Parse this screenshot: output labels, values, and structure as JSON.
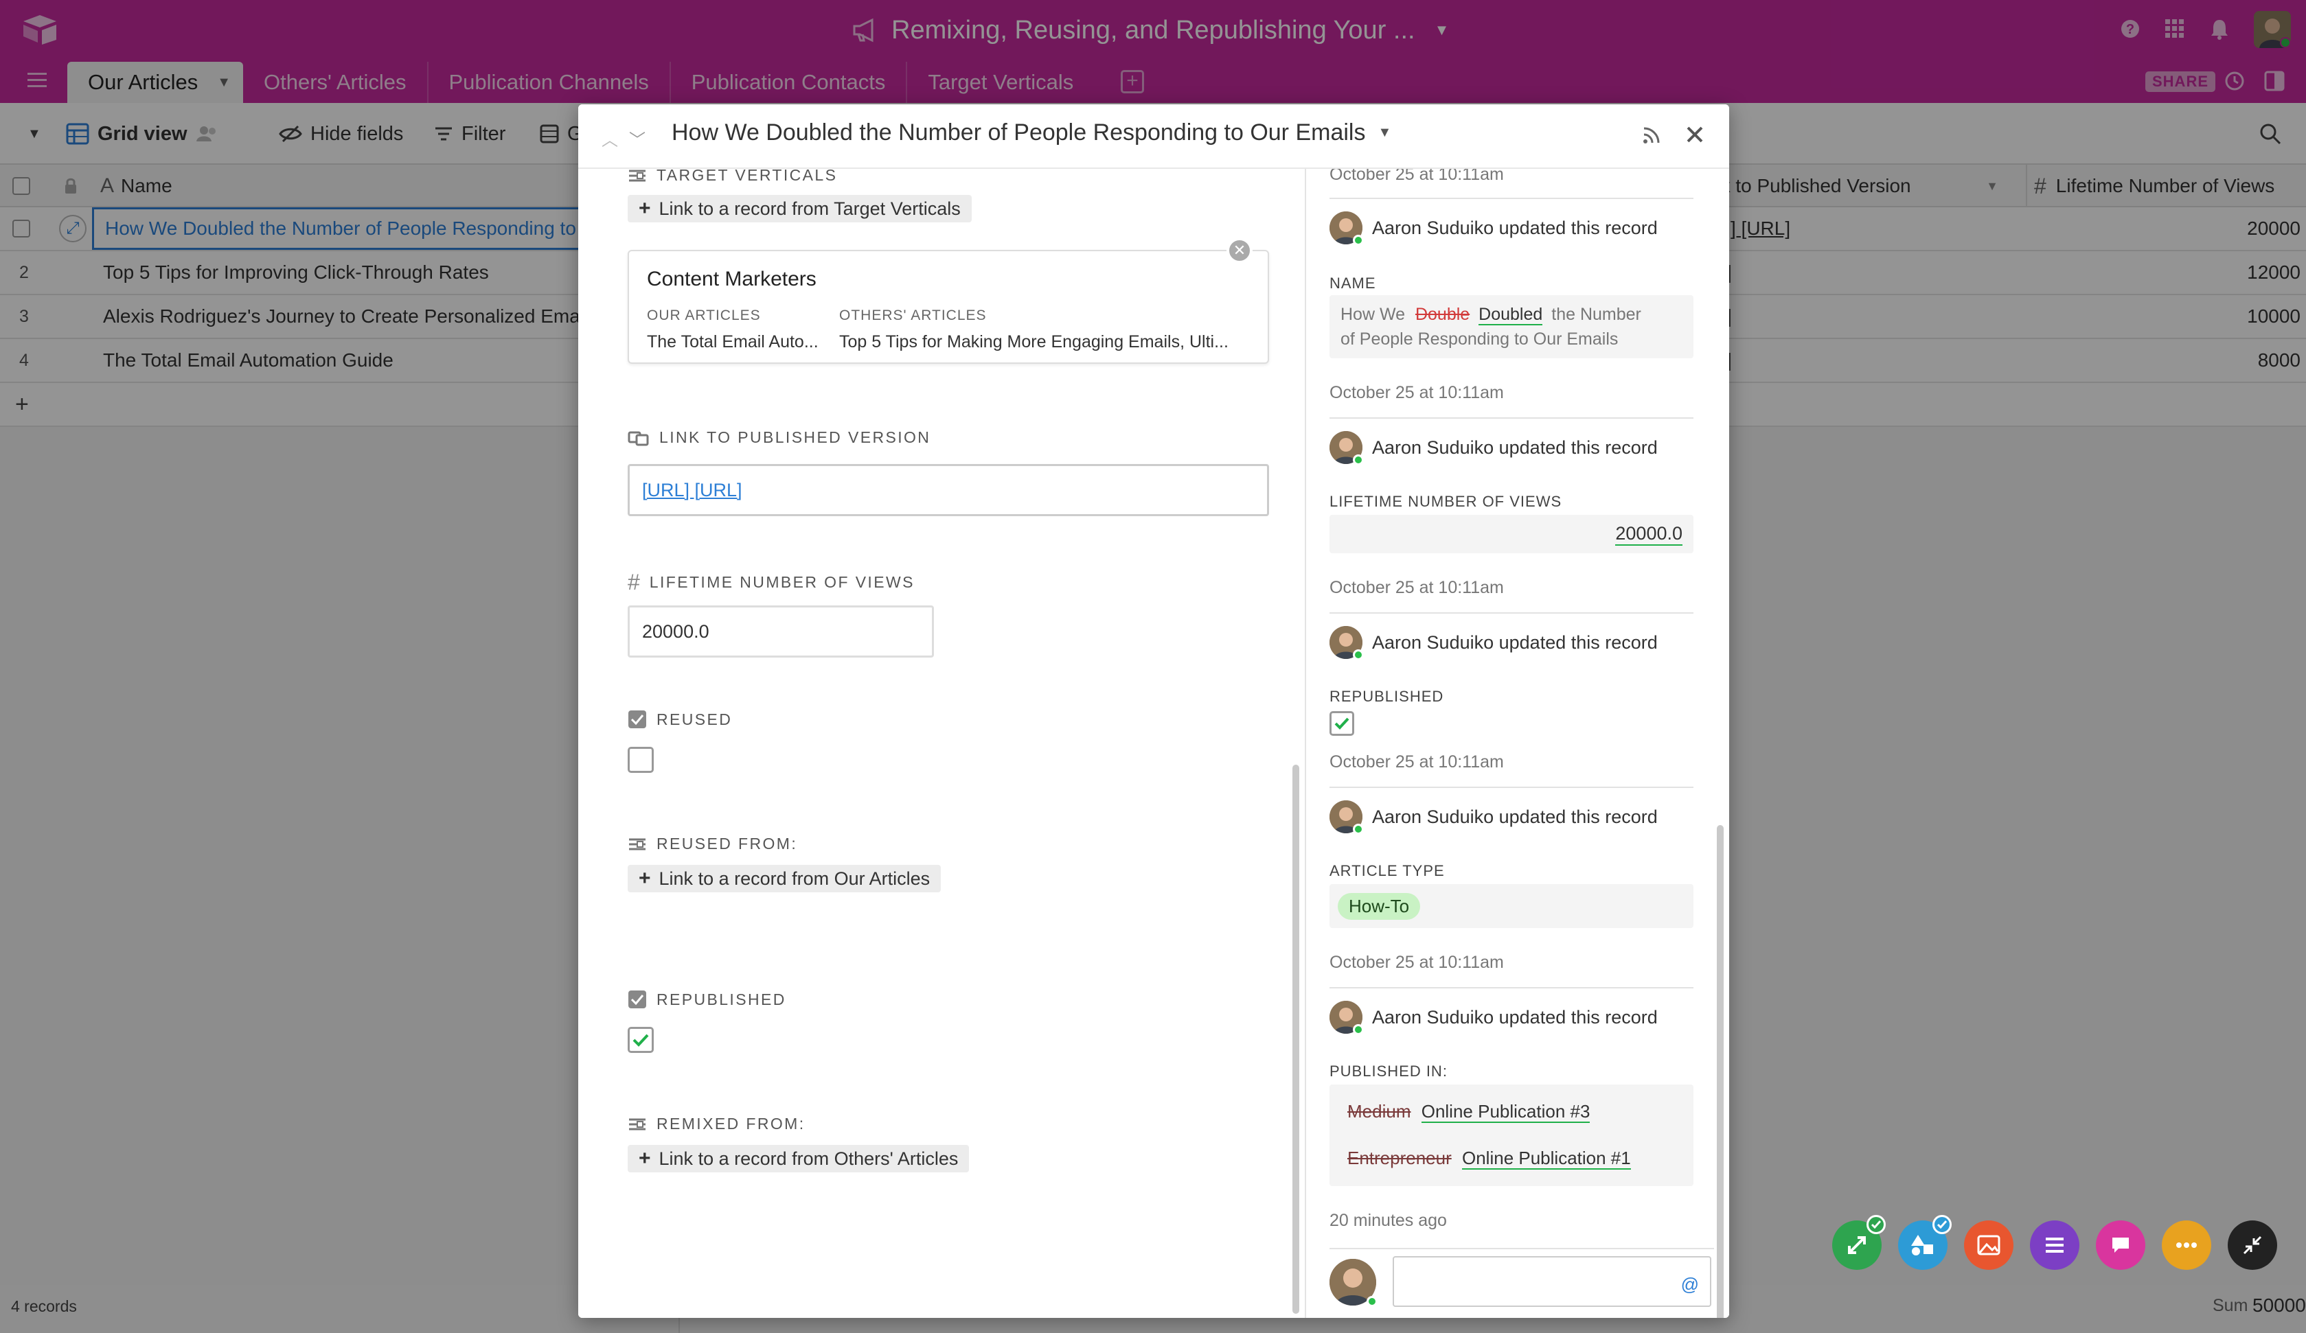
{
  "base": {
    "title": "Remixing, Reusing, and Republishing Your ..."
  },
  "tabs": [
    "Our Articles",
    "Others' Articles",
    "Publication Channels",
    "Publication Contacts",
    "Target Verticals"
  ],
  "share_label": "SHARE",
  "toolbar": {
    "view_name": "Grid view",
    "hide_fields": "Hide fields",
    "filter": "Filter",
    "group_partial": "G"
  },
  "grid": {
    "col_name": "Name",
    "col_link": "nk to Published Version",
    "col_views": "Lifetime Number of Views",
    "rows": [
      {
        "num": "",
        "name": "How We Doubled the Number of People Responding to O",
        "link": "] [URL]",
        "views": "20000"
      },
      {
        "num": "2",
        "name": "Top 5 Tips for Improving Click-Through Rates",
        "link": "]",
        "views": "12000"
      },
      {
        "num": "3",
        "name": "Alexis Rodriguez's Journey to Create Personalized Email",
        "link": "]",
        "views": "10000"
      },
      {
        "num": "4",
        "name": "The Total Email Automation Guide",
        "link": "]",
        "views": "8000"
      }
    ],
    "add_row": "+"
  },
  "footer": {
    "records": "4 records",
    "sum_label": "Sum",
    "sum_value": "50000"
  },
  "record": {
    "title": "How We Doubled the Number of People Responding to Our Emails",
    "fields": {
      "target_verticals_label": "TARGET VERTICALS",
      "target_verticals_link": "Link to a record from Target Verticals",
      "linked_card": {
        "title": "Content Marketers",
        "col1_label": "OUR ARTICLES",
        "col1_value": "The Total Email Auto...",
        "col2_label": "OTHERS' ARTICLES",
        "col2_value": "Top 5 Tips for Making More Engaging Emails, Ulti..."
      },
      "published_label": "LINK TO PUBLISHED VERSION",
      "published_value": "[URL] [URL]",
      "views_label": "LIFETIME NUMBER OF VIEWS",
      "views_value": "20000.0",
      "reused_label": "REUSED",
      "reused_checked": false,
      "reused_from_label": "REUSED FROM:",
      "reused_from_link": "Link to a record from Our Articles",
      "republished_label": "REPUBLISHED",
      "republished_checked": true,
      "remixed_from_label": "REMIXED FROM:",
      "remixed_from_link": "Link to a record from Others' Articles"
    }
  },
  "activity": {
    "top_time": "October 25 at 10:11am",
    "entries": [
      {
        "user": "Aaron Suduiko updated this record",
        "field": "NAME",
        "name_prefix": "How We",
        "name_removed": "Double",
        "name_added": "Doubled",
        "name_rest": "the Number",
        "name_line2": "of People Responding to Our Emails",
        "time": "October 25 at 10:11am"
      },
      {
        "user": "Aaron Suduiko updated this record",
        "field": "LIFETIME NUMBER OF VIEWS",
        "value": "20000.0",
        "time": "October 25 at 10:11am"
      },
      {
        "user": "Aaron Suduiko updated this record",
        "field": "REPUBLISHED",
        "checked": true,
        "time": "October 25 at 10:11am"
      },
      {
        "user": "Aaron Suduiko updated this record",
        "field": "ARTICLE TYPE",
        "value": "How-To",
        "time": "October 25 at 10:11am"
      },
      {
        "user": "Aaron Suduiko updated this record",
        "field": "PUBLISHED IN:",
        "removed1": "Medium",
        "added1": "Online Publication #3",
        "removed2": "Entrepreneur",
        "added2": "Online Publication #1",
        "time": "20 minutes ago"
      }
    ],
    "comment_at": "@"
  },
  "colors": {
    "brand": "#c42a9e",
    "fab": [
      "#2ea44f",
      "#2d9bd6",
      "#e8562f",
      "#7c3fc4",
      "#d9359e",
      "#e8a21f",
      "#222222"
    ]
  }
}
